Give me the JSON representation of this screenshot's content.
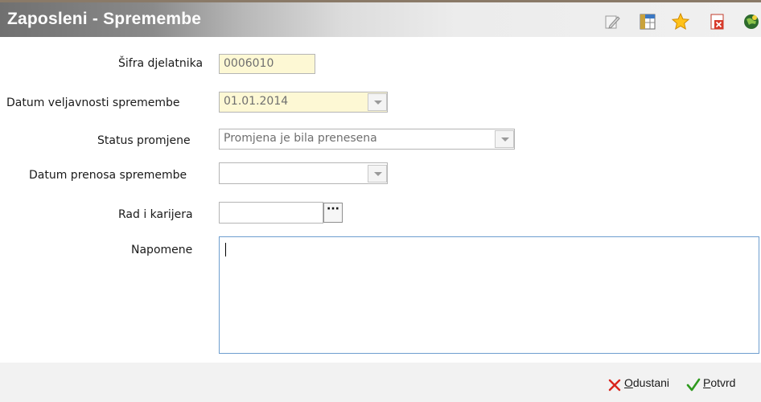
{
  "window": {
    "title": "Zaposleni - Spremembe",
    "toolbar_icons": [
      "edit-icon",
      "table-icon",
      "favorite-star-icon",
      "close-document-icon",
      "info-globe-icon"
    ]
  },
  "form": {
    "sifra": {
      "label": "Šifra djelatnika",
      "value": "0006010"
    },
    "datum_veljavnosti": {
      "label": "Datum veljavnosti spremembe",
      "value": "01.01.2014"
    },
    "status": {
      "label": "Status promjene",
      "value": "Promjena je bila prenesena"
    },
    "datum_prenosa": {
      "label": "Datum prenosa spremembe",
      "value": ""
    },
    "rad_karijera": {
      "label": "Rad i karijera",
      "value": "",
      "button": "···"
    },
    "napomene": {
      "label": "Napomene",
      "value": ""
    }
  },
  "footer": {
    "cancel": {
      "first": "O",
      "rest": "dustani"
    },
    "confirm": {
      "first": "P",
      "rest": "otvrd"
    }
  },
  "colors": {
    "required_field_bg": "#fdf8d4",
    "cancel_icon": "#d9251d",
    "confirm_icon": "#2f9a1f"
  }
}
